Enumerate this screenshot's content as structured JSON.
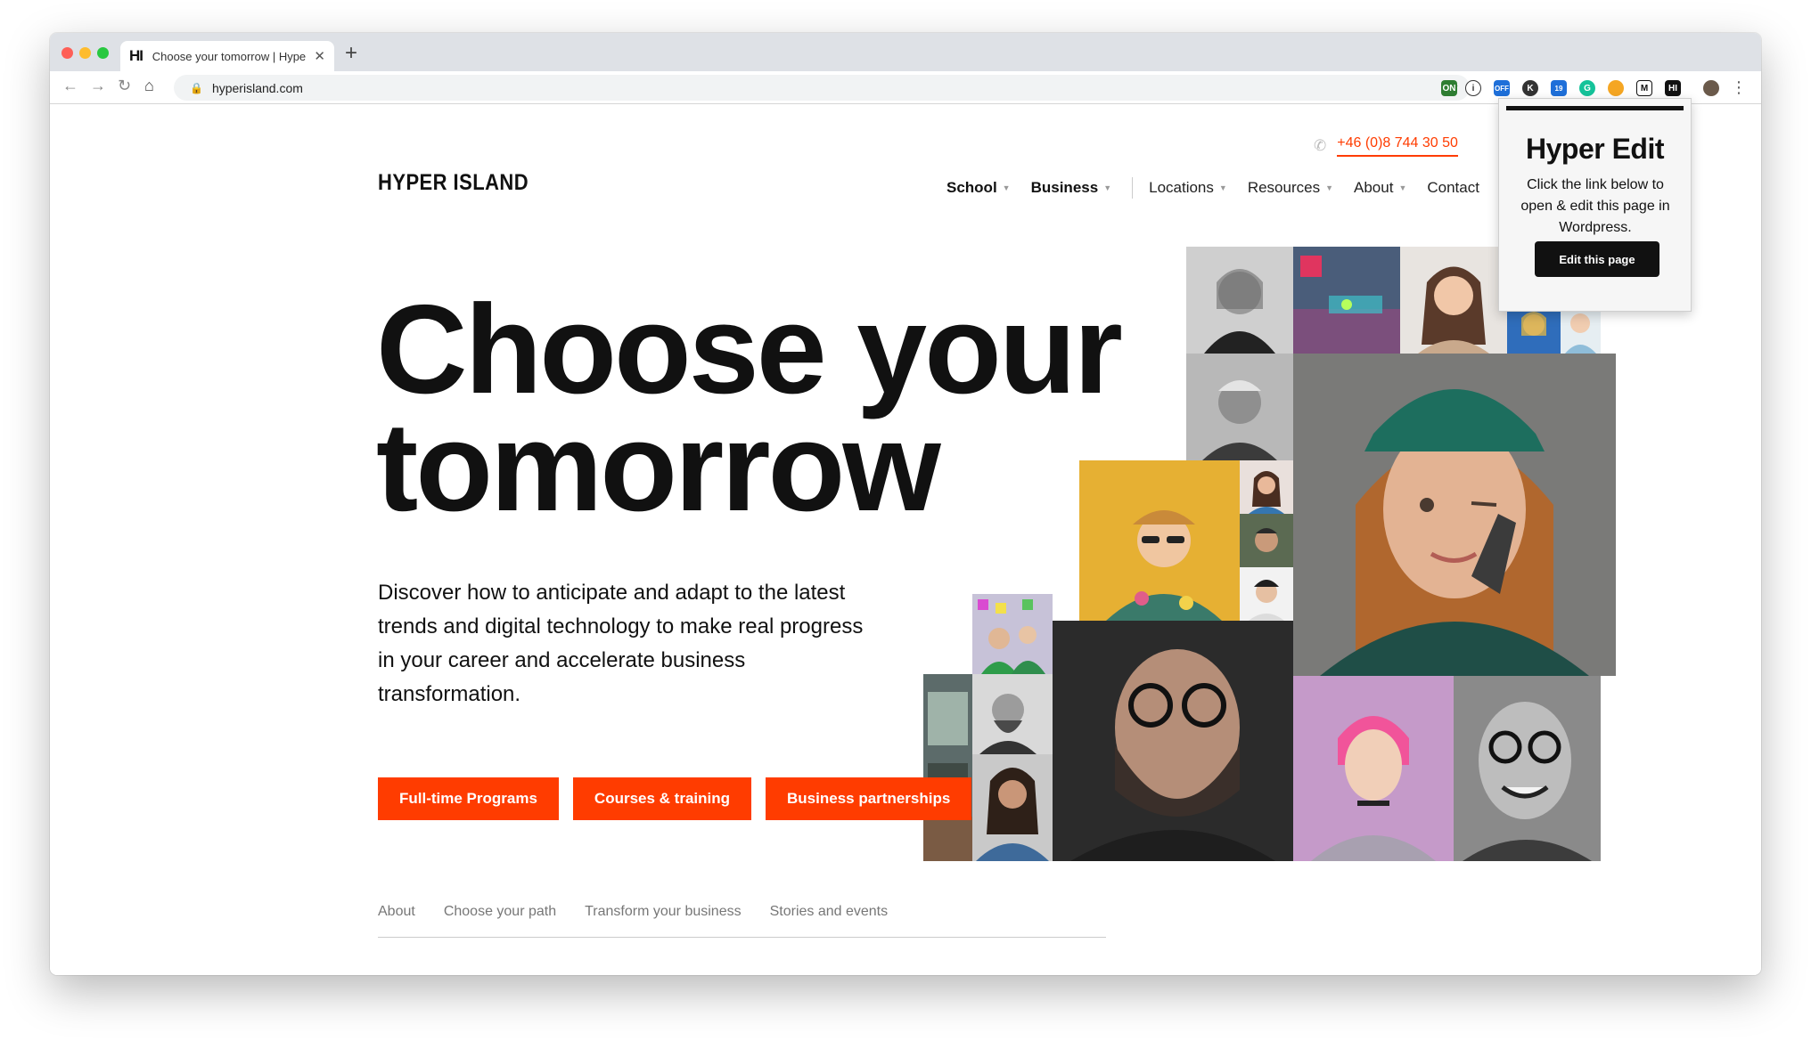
{
  "browser": {
    "tab_title": "Choose your tomorrow | Hyper",
    "tab_favicon": "HI",
    "url": "hyperisland.com",
    "extensions": [
      "ON",
      "i",
      "OFF",
      "K",
      "19",
      "G",
      "●",
      "M",
      "HI"
    ]
  },
  "header": {
    "phone": "+46 (0)8 744 30 50",
    "logo": "HYPER ISLAND",
    "nav": [
      {
        "label": "School",
        "bold": true,
        "caret": true
      },
      {
        "label": "Business",
        "bold": true,
        "caret": true
      },
      {
        "label": "Locations",
        "bold": false,
        "caret": true
      },
      {
        "label": "Resources",
        "bold": false,
        "caret": true
      },
      {
        "label": "About",
        "bold": false,
        "caret": true
      },
      {
        "label": "Contact",
        "bold": false,
        "caret": false
      }
    ]
  },
  "hero": {
    "title_line1": "Choose your",
    "title_line2": "tomorrow",
    "description": "Discover how to anticipate and adapt to the latest trends and digital technology to make real progress in your career and accelerate business transformation.",
    "ctas": [
      "Full-time Programs",
      "Courses & training",
      "Business partnerships"
    ]
  },
  "subnav": [
    "About",
    "Choose your path",
    "Transform your business",
    "Stories and events"
  ],
  "popup": {
    "title": "Hyper Edit",
    "body": "Click the link below to open & edit this page in Wordpress.",
    "button": "Edit this page"
  },
  "colors": {
    "accent": "#ff3c00",
    "text": "#111111",
    "chrome": "#dee1e6"
  }
}
